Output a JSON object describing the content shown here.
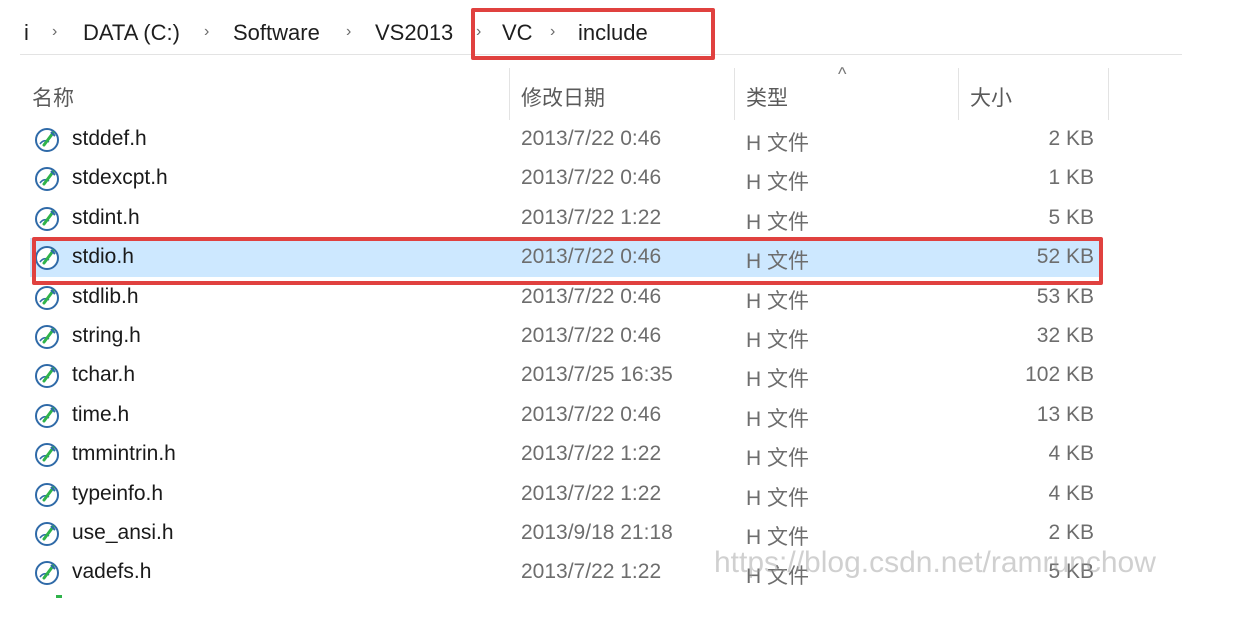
{
  "breadcrumb": {
    "lead_glyph": "i",
    "items": [
      "DATA (C:)",
      "Software",
      "VS2013",
      "VC",
      "include"
    ],
    "separator": "›"
  },
  "columns": {
    "name": "名称",
    "date": "修改日期",
    "type": "类型",
    "size": "大小",
    "sort_indicator": "^"
  },
  "files": [
    {
      "name": "stddef.h",
      "date": "2013/7/22 0:46",
      "type": "H 文件",
      "size": "2 KB"
    },
    {
      "name": "stdexcpt.h",
      "date": "2013/7/22 0:46",
      "type": "H 文件",
      "size": "1 KB"
    },
    {
      "name": "stdint.h",
      "date": "2013/7/22 1:22",
      "type": "H 文件",
      "size": "5 KB"
    },
    {
      "name": "stdio.h",
      "date": "2013/7/22 0:46",
      "type": "H 文件",
      "size": "52 KB"
    },
    {
      "name": "stdlib.h",
      "date": "2013/7/22 0:46",
      "type": "H 文件",
      "size": "53 KB"
    },
    {
      "name": "string.h",
      "date": "2013/7/22 0:46",
      "type": "H 文件",
      "size": "32 KB"
    },
    {
      "name": "tchar.h",
      "date": "2013/7/25 16:35",
      "type": "H 文件",
      "size": "102 KB"
    },
    {
      "name": "time.h",
      "date": "2013/7/22 0:46",
      "type": "H 文件",
      "size": "13 KB"
    },
    {
      "name": "tmmintrin.h",
      "date": "2013/7/22 1:22",
      "type": "H 文件",
      "size": "4 KB"
    },
    {
      "name": "typeinfo.h",
      "date": "2013/7/22 1:22",
      "type": "H 文件",
      "size": "4 KB"
    },
    {
      "name": "use_ansi.h",
      "date": "2013/9/18 21:18",
      "type": "H 文件",
      "size": "2 KB"
    },
    {
      "name": "vadefs.h",
      "date": "2013/7/22 1:22",
      "type": "H 文件",
      "size": "5 KB"
    }
  ],
  "selected_file": "stdio.h",
  "watermark": "https://blog.csdn.net/ramrunchow",
  "colors": {
    "highlight_box": "#e0413f",
    "selected_row": "#cde8ff",
    "icon_accent": "#2fb34a"
  },
  "icons": {
    "file": "c-header-file-icon"
  }
}
